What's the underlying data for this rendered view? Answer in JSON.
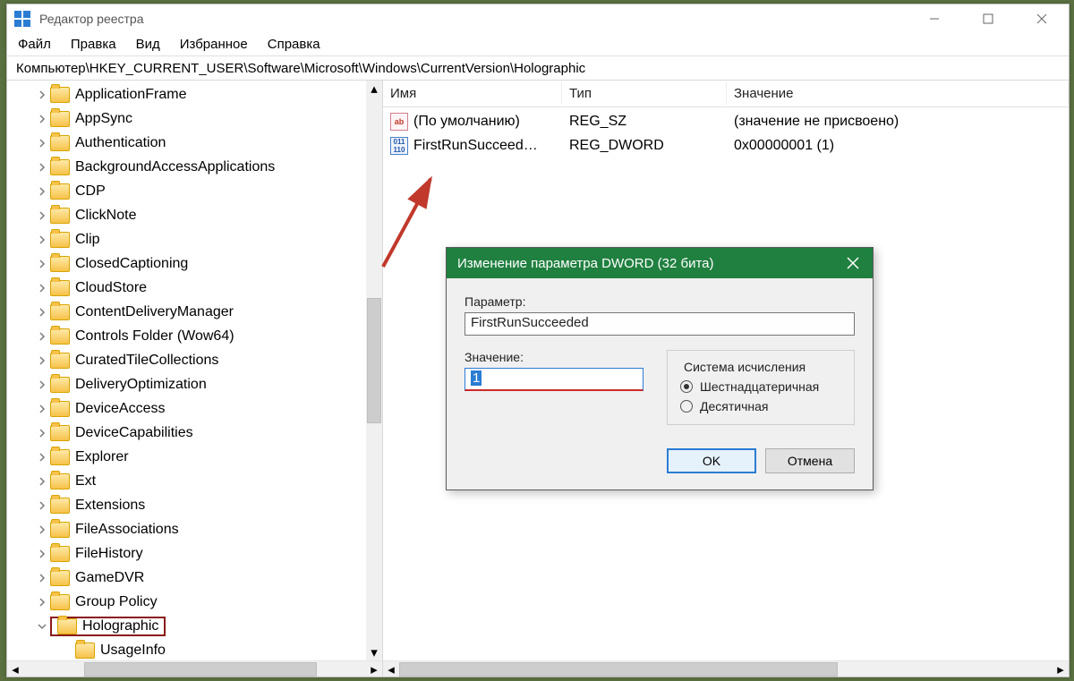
{
  "titlebar": {
    "title": "Редактор реестра"
  },
  "menu": [
    "Файл",
    "Правка",
    "Вид",
    "Избранное",
    "Справка"
  ],
  "address": "Компьютер\\HKEY_CURRENT_USER\\Software\\Microsoft\\Windows\\CurrentVersion\\Holographic",
  "tree": {
    "items": [
      "ApplicationFrame",
      "AppSync",
      "Authentication",
      "BackgroundAccessApplications",
      "CDP",
      "ClickNote",
      "Clip",
      "ClosedCaptioning",
      "CloudStore",
      "ContentDeliveryManager",
      "Controls Folder (Wow64)",
      "CuratedTileCollections",
      "DeliveryOptimization",
      "DeviceAccess",
      "DeviceCapabilities",
      "Explorer",
      "Ext",
      "Extensions",
      "FileAssociations",
      "FileHistory",
      "GameDVR",
      "Group Policy",
      "Holographic"
    ],
    "selected": "Holographic",
    "child": "UsageInfo"
  },
  "list": {
    "headers": {
      "name": "Имя",
      "type": "Тип",
      "value": "Значение"
    },
    "col_widths": {
      "name": 200,
      "type": 184,
      "value": 320
    },
    "rows": [
      {
        "icon": "str",
        "name": "(По умолчанию)",
        "type": "REG_SZ",
        "value": "(значение не присвоено)"
      },
      {
        "icon": "dword",
        "name": "FirstRunSucceed…",
        "type": "REG_DWORD",
        "value": "0x00000001 (1)"
      }
    ]
  },
  "dialog": {
    "title": "Изменение параметра DWORD (32 бита)",
    "param_label": "Параметр:",
    "param_value": "FirstRunSucceeded",
    "value_label": "Значение:",
    "value_value": "1",
    "group_label": "Система исчисления",
    "radio_hex": "Шестнадцатеричная",
    "radio_dec": "Десятичная",
    "ok": "OK",
    "cancel": "Отмена"
  }
}
